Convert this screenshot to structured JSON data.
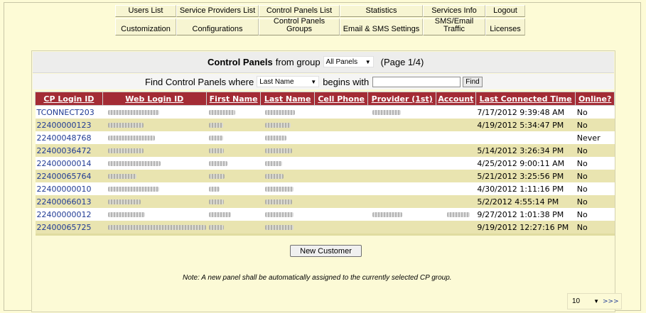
{
  "nav": {
    "row1": [
      "Users List",
      "Service Providers List",
      "Control Panels List",
      "Statistics",
      "Services Info",
      "Logout"
    ],
    "row2": [
      "Customization",
      "Configurations",
      "Control Panels Groups",
      "Email & SMS Settings",
      "SMS/Email Traffic",
      "Licenses"
    ]
  },
  "title": {
    "bold": "Control Panels",
    "from": "from group",
    "group_value": "All Panels",
    "page": "(Page 1/4)"
  },
  "find": {
    "label": "Find Control Panels where",
    "field_value": "Last Name",
    "begins": "begins with",
    "input_value": "",
    "button": "Find"
  },
  "table": {
    "headers": [
      "CP Login ID",
      "Web Login ID",
      "First Name",
      "Last Name",
      "Cell Phone",
      "Provider (1st)",
      "Account",
      "Last Connected Time",
      "Online?"
    ],
    "rows": [
      {
        "cp": "TCONNECT203",
        "last": "7/17/2012 9:39:48 AM",
        "online": "No"
      },
      {
        "cp": "22400000123",
        "last": "4/19/2012 5:34:47 PM",
        "online": "No"
      },
      {
        "cp": "22400048768",
        "last": "",
        "online": "Never"
      },
      {
        "cp": "22400036472",
        "last": "5/14/2012 3:26:34 PM",
        "online": "No"
      },
      {
        "cp": "22400000014",
        "last": "4/25/2012 9:00:11 AM",
        "online": "No"
      },
      {
        "cp": "22400065764",
        "last": "5/21/2012 3:25:56 PM",
        "online": "No"
      },
      {
        "cp": "22400000010",
        "last": "4/30/2012 1:11:16 PM",
        "online": "No"
      },
      {
        "cp": "22400066013",
        "last": "5/2/2012 4:55:14 PM",
        "online": "No"
      },
      {
        "cp": "22400000012",
        "last": "9/27/2012 1:01:38 PM",
        "online": "No"
      },
      {
        "cp": "22400065725",
        "last": "9/19/2012 12:27:16 PM",
        "online": "No"
      }
    ]
  },
  "new_customer": "New Customer",
  "note": "Note: A new panel shall be automatically assigned to the currently selected CP group.",
  "pager": {
    "page_size": "10",
    "next": ">>>"
  },
  "colors": {
    "header_bg": "#a32c35",
    "page_bg": "#fdfbd6",
    "row_alt": "#e9e4b0",
    "link": "#1f3a94"
  },
  "icons": {
    "dropdown": "chevron-down-icon"
  }
}
